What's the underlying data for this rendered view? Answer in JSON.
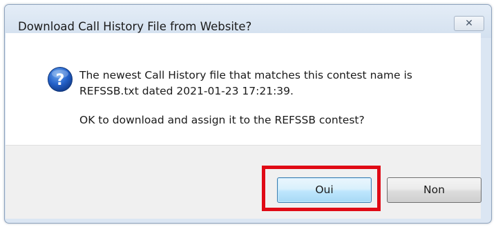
{
  "dialog": {
    "title": "Download Call History File from Website?",
    "close_icon": "close-icon",
    "message_icon": "question-icon",
    "message_line1": "The newest Call History file that matches this contest name is",
    "message_line2": "REFSSB.txt dated 2021-01-23 17:21:39.",
    "message_line3": "OK to download and assign it to the REFSSB contest?",
    "buttons": {
      "yes_label": "Oui",
      "no_label": "Non"
    }
  },
  "colors": {
    "highlight": "#e00a15",
    "titlebar": "#d3e0ef",
    "default_button_border": "#3c7fb1"
  }
}
